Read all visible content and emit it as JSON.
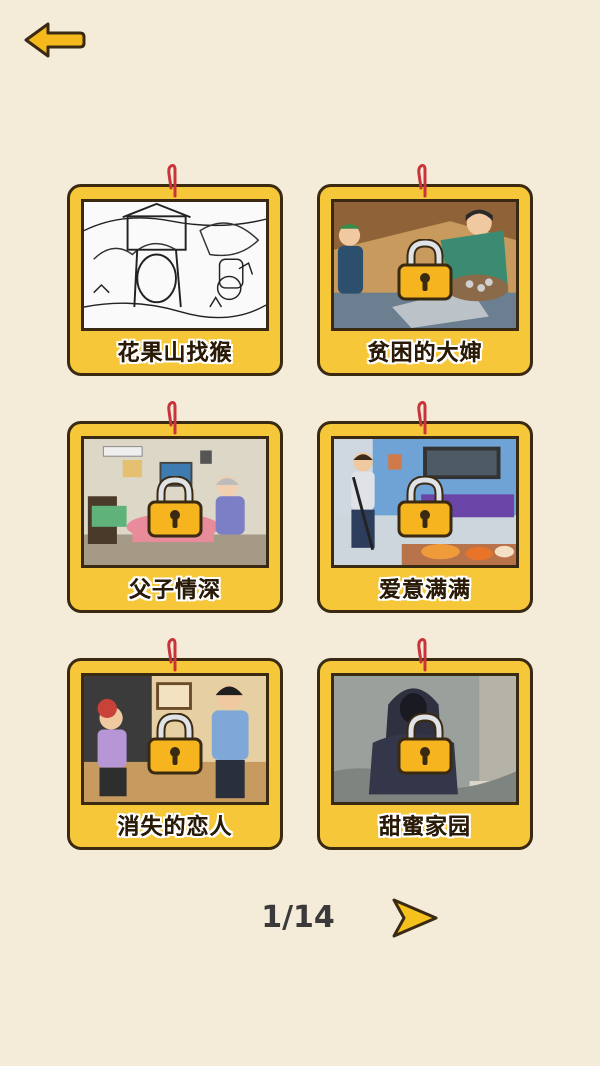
{
  "header": {
    "back_icon": "arrow-left-icon"
  },
  "levels": [
    {
      "title": "花果山找猴",
      "locked": false
    },
    {
      "title": "贫困的大婶",
      "locked": true
    },
    {
      "title": "父子情深",
      "locked": true
    },
    {
      "title": "爱意满满",
      "locked": true
    },
    {
      "title": "消失的恋人",
      "locked": true
    },
    {
      "title": "甜蜜家园",
      "locked": true
    }
  ],
  "pager": {
    "page_label": "1/14",
    "next_icon": "arrow-right-icon"
  },
  "colors": {
    "background": "#f4ecd9",
    "card": "#f6c738",
    "outline": "#3a2a12"
  }
}
